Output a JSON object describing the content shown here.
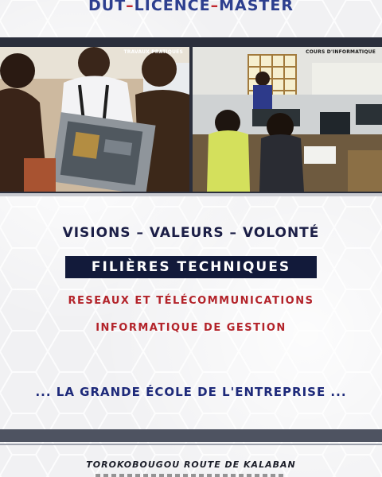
{
  "header": {
    "part1": "DUT",
    "dash1": "–",
    "part2": "LICENCE",
    "dash2": "–",
    "part3": "MASTER"
  },
  "photos": {
    "left_caption": "TRAVAUX PRATIQUES",
    "right_caption": "COURS D'INFORMATIQUE"
  },
  "slogan": "VISIONS – VALEURS – VOLONTÉ",
  "section_title": "FILIÈRES TECHNIQUES",
  "programs": [
    "RESEAUX ET TÉLÉCOMMUNICATIONS",
    "INFORMATIQUE DE GESTION"
  ],
  "tagline": "... LA GRANDE ÉCOLE DE L'ENTREPRISE ...",
  "address": "TOROKOBOUGOU ROUTE DE KALABAN",
  "colors": {
    "title_blue": "#2d3f8f",
    "dash_red": "#c2272d",
    "banner_navy": "#121a3a",
    "program_red": "#b3232a",
    "tagline_blue": "#1e2a7a"
  }
}
